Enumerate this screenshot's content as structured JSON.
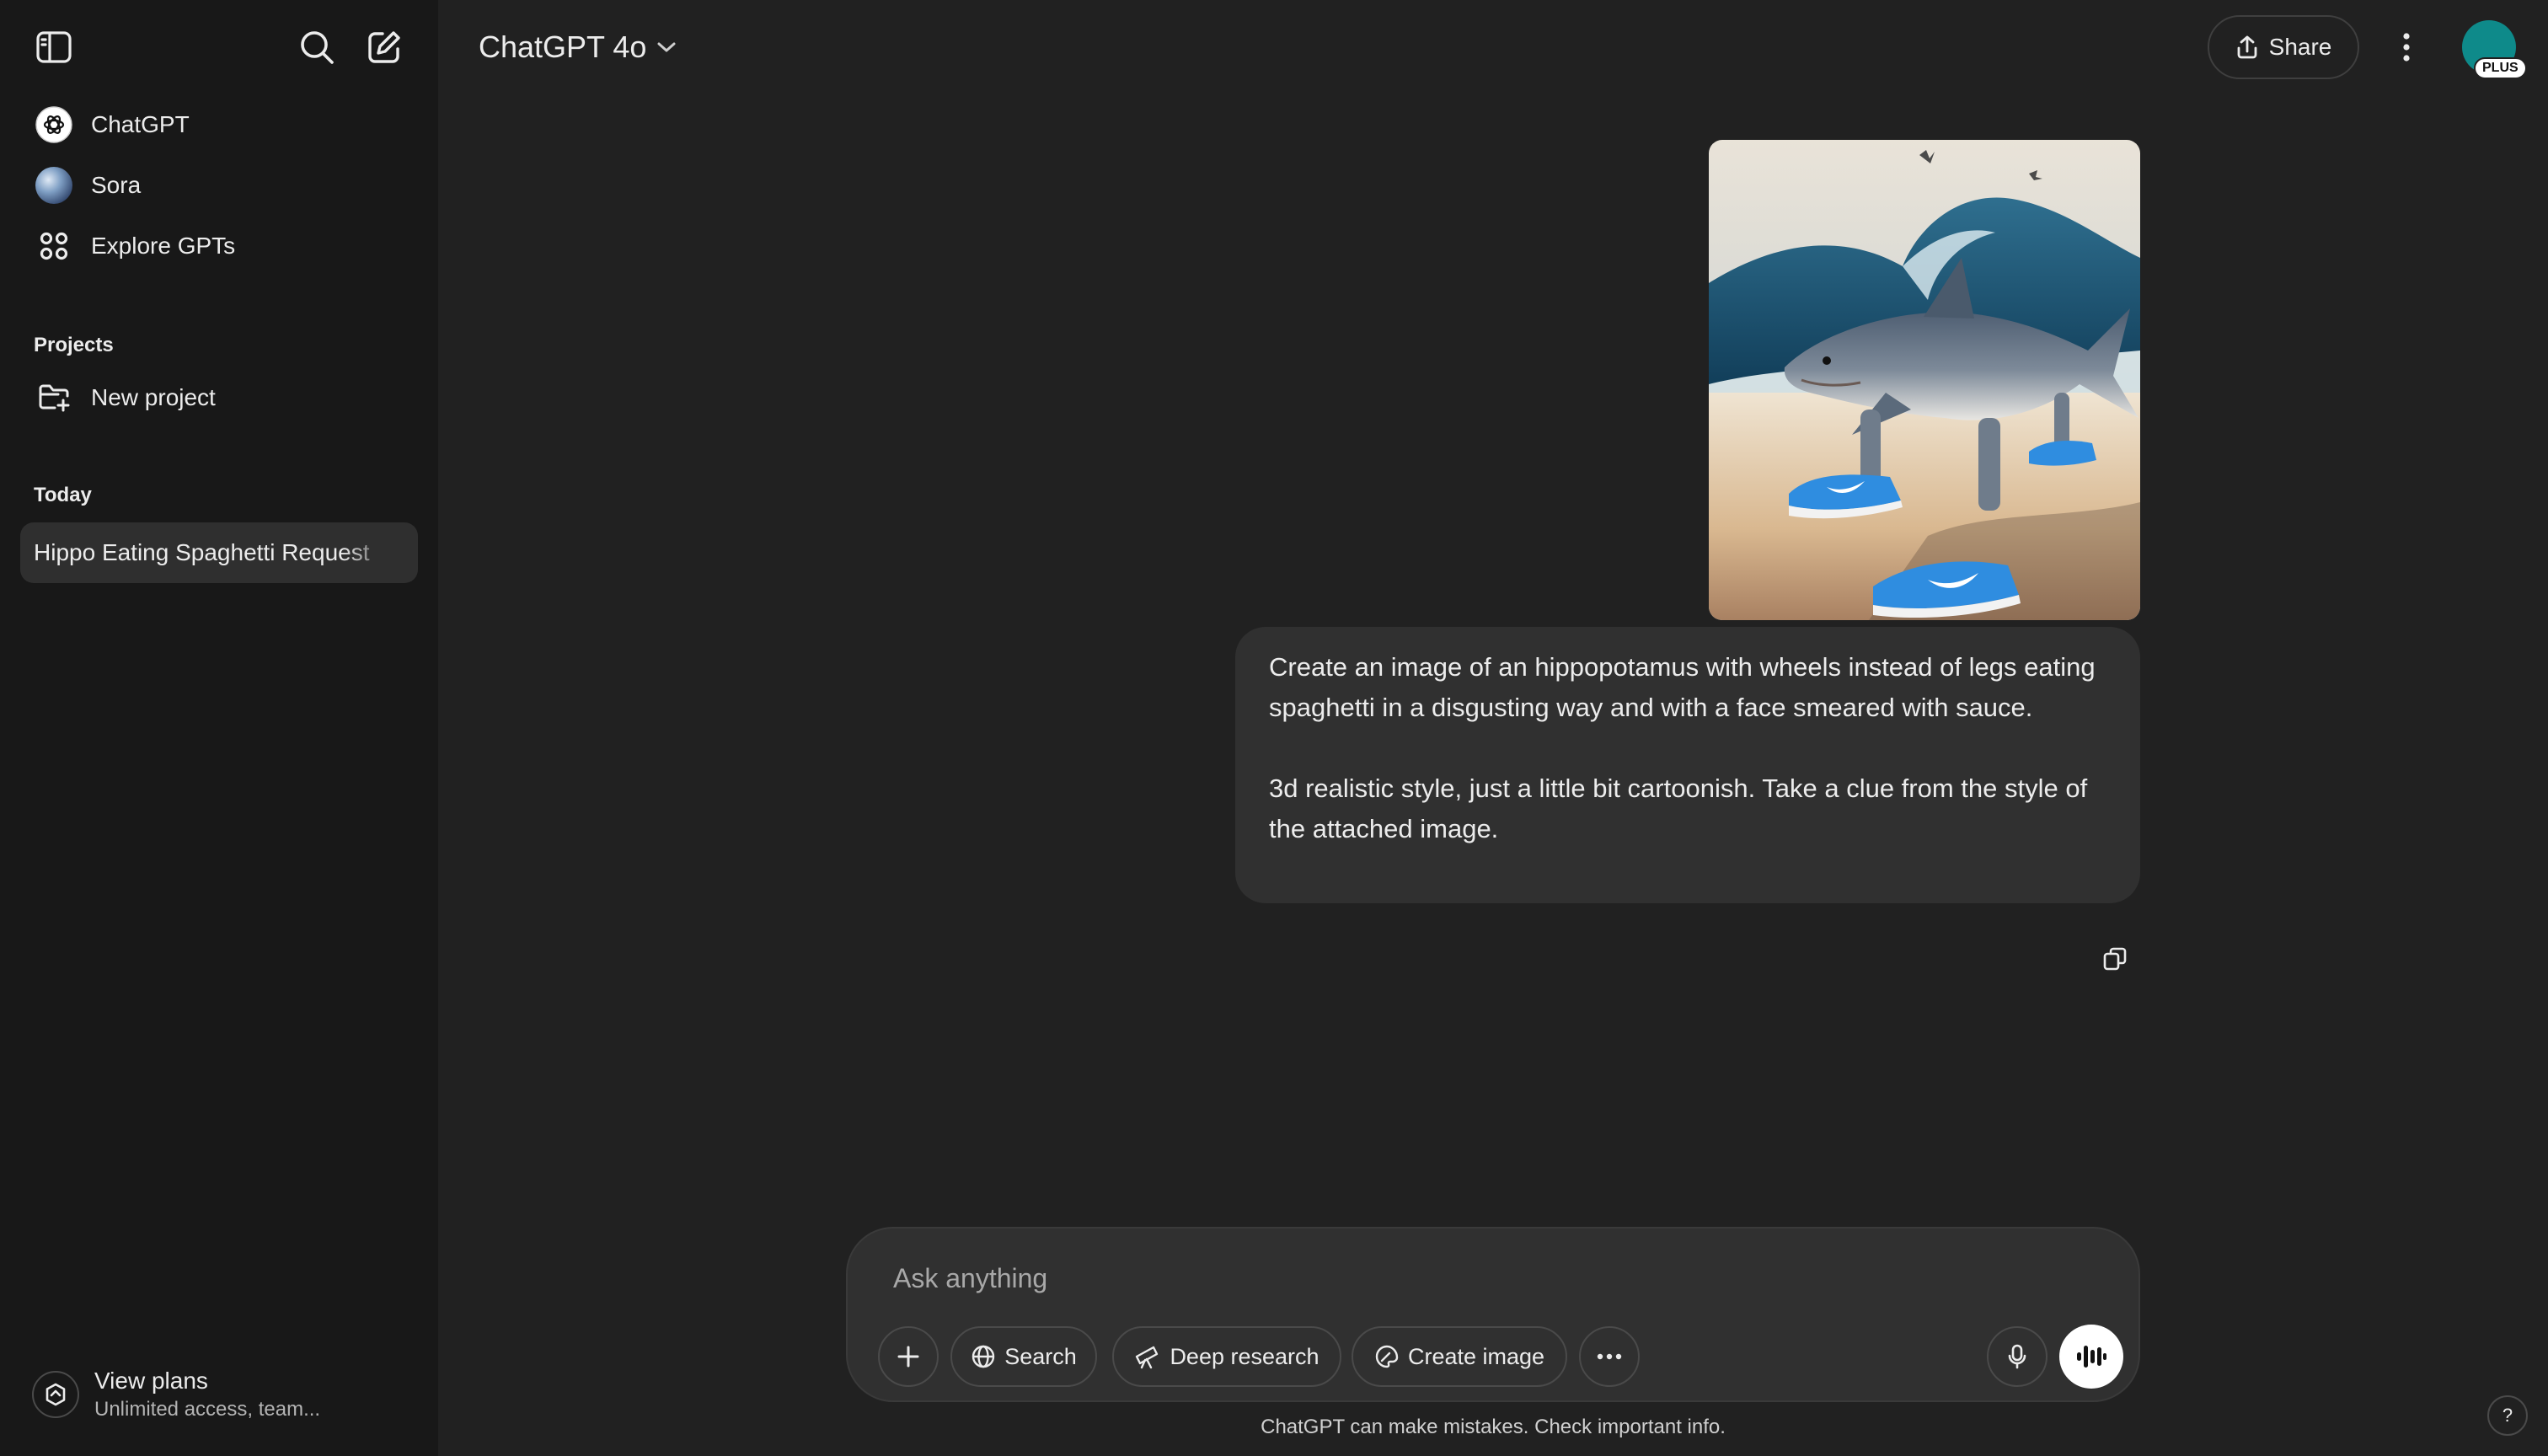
{
  "sidebar": {
    "nav": [
      {
        "label": "ChatGPT",
        "icon": "openai-logo-icon"
      },
      {
        "label": "Sora",
        "icon": "sora-orb-icon"
      },
      {
        "label": "Explore GPTs",
        "icon": "grid-icon"
      }
    ],
    "projects_heading": "Projects",
    "new_project_label": "New project",
    "today_heading": "Today",
    "history": [
      {
        "title": "Hippo Eating Spaghetti Request",
        "active": true
      }
    ],
    "view_plans": {
      "title": "View plans",
      "subtitle": "Unlimited access, team..."
    }
  },
  "header": {
    "model": "ChatGPT 4o",
    "share_label": "Share",
    "badge": "PLUS",
    "avatar_color": "#0e8a8a"
  },
  "conversation": {
    "attachment": {
      "kind": "image",
      "description_icon": "shark-in-sneakers-image"
    },
    "user_message": [
      "Create an image of an hippopotamus with wheels instead of legs eating spaghetti in a disgusting way and with a face smeared with sauce.",
      "3d realistic style, just a little bit cartoonish. Take a clue from the style of the attached image."
    ]
  },
  "composer": {
    "placeholder": "Ask anything",
    "tools": {
      "search": "Search",
      "deep_research": "Deep research",
      "create_image": "Create image"
    }
  },
  "footer": {
    "disclaimer": "ChatGPT can make mistakes. Check important info.",
    "help": "?"
  },
  "colors": {
    "background": "#212121",
    "sidebar": "#181818",
    "bubble": "#303030",
    "text": "#ececec"
  }
}
